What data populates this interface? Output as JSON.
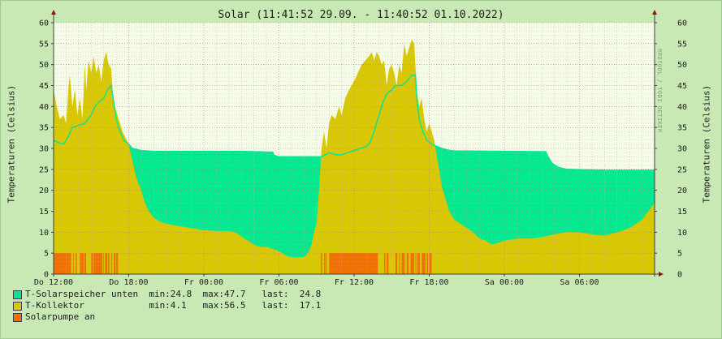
{
  "chart_data": {
    "type": "area",
    "title": "Solar (11:41:52 29.09. - 11:40:52 01.10.2022)",
    "ylabel": "Temperaturen (Celsius)",
    "ylim": [
      0,
      60
    ],
    "yticks": [
      0,
      5,
      10,
      15,
      20,
      25,
      30,
      35,
      40,
      45,
      50,
      55,
      60
    ],
    "x_unit": "hours since Do 12:00",
    "xlim": [
      0,
      48
    ],
    "xticks": [
      {
        "label": "Do 12:00",
        "x": 0
      },
      {
        "label": "Do 18:00",
        "x": 6
      },
      {
        "label": "Fr 00:00",
        "x": 12
      },
      {
        "label": "Fr 06:00",
        "x": 18
      },
      {
        "label": "Fr 12:00",
        "x": 24
      },
      {
        "label": "Fr 18:00",
        "x": 30
      },
      {
        "label": "Sa 00:00",
        "x": 36
      },
      {
        "label": "Sa 06:00",
        "x": 42
      }
    ],
    "grid": true,
    "series": [
      {
        "name": "T-Solarspeicher unten",
        "color": "#00e890",
        "points": [
          [
            0,
            32
          ],
          [
            0.3,
            31.5
          ],
          [
            0.8,
            31
          ],
          [
            1.2,
            33
          ],
          [
            1.5,
            35
          ],
          [
            2.0,
            35.5
          ],
          [
            2.5,
            36
          ],
          [
            3.0,
            38
          ],
          [
            3.3,
            40
          ],
          [
            3.6,
            41
          ],
          [
            4.0,
            42
          ],
          [
            4.3,
            44
          ],
          [
            4.6,
            45
          ],
          [
            4.8,
            41
          ],
          [
            5.0,
            37
          ],
          [
            5.3,
            34
          ],
          [
            5.6,
            32
          ],
          [
            6.0,
            31
          ],
          [
            6.3,
            30
          ],
          [
            7.0,
            29.5
          ],
          [
            8,
            29.3
          ],
          [
            10,
            29.3
          ],
          [
            12,
            29.3
          ],
          [
            15,
            29.3
          ],
          [
            17.5,
            29.1
          ],
          [
            17.6,
            28.4
          ],
          [
            18,
            28
          ],
          [
            20,
            28
          ],
          [
            21.4,
            28
          ],
          [
            21.7,
            28.5
          ],
          [
            22,
            29
          ],
          [
            22.5,
            28.5
          ],
          [
            23,
            28.5
          ],
          [
            24,
            29.5
          ],
          [
            24.5,
            30
          ],
          [
            25,
            30.5
          ],
          [
            25.3,
            31.5
          ],
          [
            25.7,
            35
          ],
          [
            26,
            38
          ],
          [
            26.3,
            41
          ],
          [
            26.6,
            43
          ],
          [
            27,
            44
          ],
          [
            27.3,
            45
          ],
          [
            27.8,
            45
          ],
          [
            28.2,
            46
          ],
          [
            28.6,
            47.5
          ],
          [
            28.9,
            47.5
          ],
          [
            29.0,
            42
          ],
          [
            29.2,
            37
          ],
          [
            29.5,
            34
          ],
          [
            29.8,
            32
          ],
          [
            30.2,
            31
          ],
          [
            30.6,
            30.5
          ],
          [
            31,
            30
          ],
          [
            31.5,
            29.6
          ],
          [
            32,
            29.4
          ],
          [
            36,
            29.3
          ],
          [
            39.3,
            29.2
          ],
          [
            39.5,
            28
          ],
          [
            39.8,
            26.5
          ],
          [
            40.3,
            25.5
          ],
          [
            41,
            25
          ],
          [
            44,
            24.8
          ],
          [
            48,
            24.8
          ]
        ]
      },
      {
        "name": "T-Kollektor",
        "color": "#d8c800",
        "points": [
          [
            0,
            44
          ],
          [
            0.25,
            40
          ],
          [
            0.5,
            37
          ],
          [
            0.8,
            38
          ],
          [
            1.0,
            36
          ],
          [
            1.2,
            45
          ],
          [
            1.3,
            47.5
          ],
          [
            1.5,
            40
          ],
          [
            1.7,
            44
          ],
          [
            1.9,
            38
          ],
          [
            2.1,
            42
          ],
          [
            2.3,
            37
          ],
          [
            2.5,
            50
          ],
          [
            2.6,
            44
          ],
          [
            2.8,
            51
          ],
          [
            3.0,
            48
          ],
          [
            3.2,
            52
          ],
          [
            3.4,
            48
          ],
          [
            3.6,
            50
          ],
          [
            3.8,
            46
          ],
          [
            4.0,
            51
          ],
          [
            4.2,
            53
          ],
          [
            4.4,
            50
          ],
          [
            4.6,
            49
          ],
          [
            4.7,
            44
          ],
          [
            4.9,
            40
          ],
          [
            5.1,
            38
          ],
          [
            5.3,
            36
          ],
          [
            5.5,
            34
          ],
          [
            6.0,
            31
          ],
          [
            6.3,
            27
          ],
          [
            6.6,
            23
          ],
          [
            7.0,
            20
          ],
          [
            7.3,
            17
          ],
          [
            7.6,
            15
          ],
          [
            8.0,
            13.5
          ],
          [
            8.5,
            12.5
          ],
          [
            9,
            12
          ],
          [
            10,
            11.5
          ],
          [
            11,
            11
          ],
          [
            12,
            10.5
          ],
          [
            13,
            10.3
          ],
          [
            14,
            10.3
          ],
          [
            14.5,
            10
          ],
          [
            15,
            9
          ],
          [
            15.5,
            8
          ],
          [
            16,
            7
          ],
          [
            16.5,
            6.5
          ],
          [
            17,
            6.5
          ],
          [
            17.5,
            6
          ],
          [
            18,
            5.5
          ],
          [
            18.5,
            4.5
          ],
          [
            19,
            4
          ],
          [
            19.5,
            4
          ],
          [
            20,
            4.1
          ],
          [
            20.3,
            5
          ],
          [
            20.6,
            7
          ],
          [
            20.8,
            10
          ],
          [
            21.0,
            12
          ],
          [
            21.2,
            20
          ],
          [
            21.4,
            30
          ],
          [
            21.6,
            34
          ],
          [
            21.8,
            30
          ],
          [
            22.0,
            36
          ],
          [
            22.2,
            38
          ],
          [
            22.5,
            37
          ],
          [
            22.8,
            40
          ],
          [
            23.0,
            38
          ],
          [
            23.3,
            42
          ],
          [
            23.6,
            44
          ],
          [
            24.0,
            46
          ],
          [
            24.3,
            48
          ],
          [
            24.6,
            50
          ],
          [
            24.9,
            51
          ],
          [
            25.2,
            52
          ],
          [
            25.4,
            53
          ],
          [
            25.6,
            51
          ],
          [
            25.8,
            53
          ],
          [
            26.0,
            52
          ],
          [
            26.2,
            50
          ],
          [
            26.4,
            51
          ],
          [
            26.6,
            45
          ],
          [
            26.8,
            49
          ],
          [
            27.0,
            50
          ],
          [
            27.2,
            48
          ],
          [
            27.4,
            45
          ],
          [
            27.6,
            50
          ],
          [
            27.8,
            48
          ],
          [
            28.0,
            55
          ],
          [
            28.2,
            52
          ],
          [
            28.4,
            54
          ],
          [
            28.6,
            56
          ],
          [
            28.8,
            55
          ],
          [
            29.0,
            44
          ],
          [
            29.2,
            40
          ],
          [
            29.4,
            42
          ],
          [
            29.6,
            37
          ],
          [
            29.8,
            34
          ],
          [
            30.0,
            36
          ],
          [
            30.2,
            34
          ],
          [
            30.4,
            32
          ],
          [
            30.6,
            28
          ],
          [
            30.8,
            25
          ],
          [
            31.0,
            21
          ],
          [
            31.3,
            18
          ],
          [
            31.6,
            15
          ],
          [
            32,
            13
          ],
          [
            32.5,
            12
          ],
          [
            33,
            11
          ],
          [
            33.5,
            10
          ],
          [
            34,
            8.5
          ],
          [
            34.5,
            8
          ],
          [
            35,
            7
          ],
          [
            35.5,
            7.5
          ],
          [
            36,
            8
          ],
          [
            37,
            8.5
          ],
          [
            38,
            8.5
          ],
          [
            39,
            8.8
          ],
          [
            40,
            9.5
          ],
          [
            41,
            10
          ],
          [
            42,
            10
          ],
          [
            43,
            9.5
          ],
          [
            44,
            9.2
          ],
          [
            45,
            10
          ],
          [
            46,
            11
          ],
          [
            46.5,
            12
          ],
          [
            47,
            13
          ],
          [
            47.5,
            15
          ],
          [
            48,
            17
          ]
        ]
      },
      {
        "name": "Solarpumpe an",
        "color": "#f07000",
        "type": "step",
        "on_value": 5,
        "intervals": [
          [
            0,
            1.4
          ],
          [
            1.55,
            1.6
          ],
          [
            1.75,
            1.85
          ],
          [
            2.1,
            2.4
          ],
          [
            2.45,
            2.6
          ],
          [
            3.0,
            3.15
          ],
          [
            3.2,
            3.9
          ],
          [
            3.95,
            4.0
          ],
          [
            4.1,
            4.3
          ],
          [
            4.35,
            4.45
          ],
          [
            4.6,
            4.65
          ],
          [
            4.8,
            4.95
          ],
          [
            5.0,
            5.15
          ],
          [
            21.35,
            21.45
          ],
          [
            21.6,
            21.7
          ],
          [
            21.75,
            21.8
          ],
          [
            22.0,
            25.9
          ],
          [
            26.4,
            26.5
          ],
          [
            26.6,
            26.75
          ],
          [
            27.3,
            27.45
          ],
          [
            27.6,
            27.65
          ],
          [
            27.8,
            28.05
          ],
          [
            28.2,
            28.35
          ],
          [
            28.5,
            28.8
          ],
          [
            28.9,
            28.95
          ],
          [
            29.05,
            29.25
          ],
          [
            29.4,
            29.7
          ],
          [
            29.8,
            29.9
          ],
          [
            30.0,
            30.2
          ]
        ]
      }
    ]
  },
  "legend": [
    {
      "color": "#00e890",
      "text": "T-Solarspeicher unten  min:24.8  max:47.7   last:  24.8"
    },
    {
      "color": "#d8c800",
      "text": "T-Kollektor            min:4.1   max:56.5   last:  17.1"
    },
    {
      "color": "#f07000",
      "text": "Solarpumpe an"
    }
  ],
  "watermark": "RRDTOOL / TOBI OETIKER"
}
